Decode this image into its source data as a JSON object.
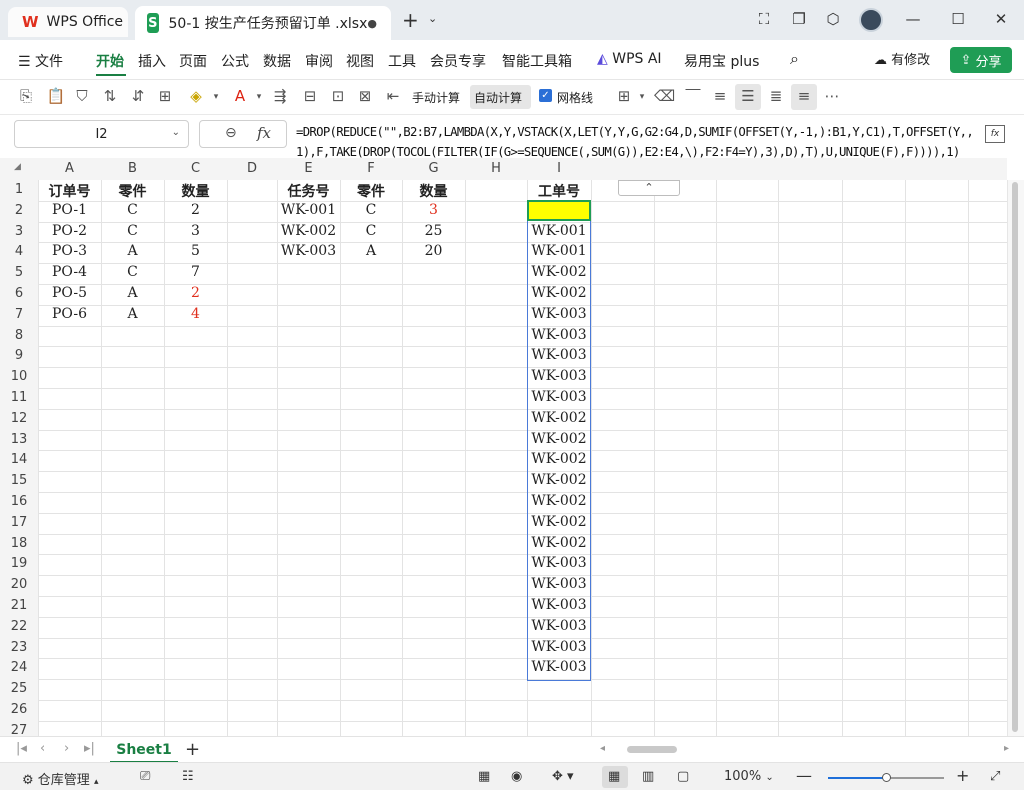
{
  "tabs": {
    "app_tab_label": "WPS Office",
    "file_tab_label": "50-1 按生产任务预留订单 .xlsx",
    "file_badge": "S",
    "modified_dot": "●"
  },
  "menu": {
    "file": "文件",
    "items": [
      "开始",
      "插入",
      "页面",
      "公式",
      "数据",
      "审阅",
      "视图",
      "工具",
      "会员专享",
      "智能工具箱",
      "WPS AI",
      "易用宝 plus"
    ],
    "active": "开始",
    "modify_label": "有修改",
    "share_label": "分享"
  },
  "toolbar": {
    "manual_calc": "手动计算",
    "auto_calc": "自动计算",
    "gridlines": "网格线",
    "gridlines_checked": true
  },
  "formula_bar": {
    "name_box": "I2",
    "formula": "=DROP(REDUCE(\"\",B2:B7,LAMBDA(X,Y,VSTACK(X,LET(Y,Y,G,G2:G4,D,SUMIF(OFFSET(Y,-1,):B1,Y,C1),T,OFFSET(Y,,1),F,TAKE(DROP(TOCOL(FILTER(IF(G>=SEQUENCE(,SUM(G)),E2:E4,\\),F2:F4=Y),3),D),T),U,UNIQUE(F),F)))),1)"
  },
  "columns": [
    "A",
    "B",
    "C",
    "D",
    "E",
    "F",
    "G",
    "H",
    "I"
  ],
  "rows": [
    "1",
    "2",
    "3",
    "4",
    "5",
    "6",
    "7",
    "8",
    "9",
    "10",
    "11",
    "12",
    "13",
    "14",
    "15",
    "16",
    "17",
    "18",
    "19",
    "20",
    "21",
    "22",
    "23",
    "24",
    "25",
    "26",
    "27"
  ],
  "orders": {
    "headers": [
      "订单号",
      "零件",
      "数量"
    ],
    "rows": [
      [
        "PO-1",
        "C",
        "2"
      ],
      [
        "PO-2",
        "C",
        "3"
      ],
      [
        "PO-3",
        "A",
        "5"
      ],
      [
        "PO-4",
        "C",
        "7"
      ],
      [
        "PO-5",
        "A",
        "2"
      ],
      [
        "PO-6",
        "A",
        "4"
      ]
    ]
  },
  "tasks": {
    "headers": [
      "任务号",
      "零件",
      "数量"
    ],
    "rows": [
      [
        "WK-001",
        "C",
        "3"
      ],
      [
        "WK-002",
        "C",
        "25"
      ],
      [
        "WK-003",
        "A",
        "20"
      ]
    ]
  },
  "result": {
    "header": "工单号",
    "values": [
      "WK-001",
      "WK-001",
      "WK-001",
      "WK-002",
      "WK-002",
      "WK-003",
      "WK-003",
      "WK-003",
      "WK-003",
      "WK-003",
      "WK-002",
      "WK-002",
      "WK-002",
      "WK-002",
      "WK-002",
      "WK-002",
      "WK-002",
      "WK-003",
      "WK-003",
      "WK-003",
      "WK-003",
      "WK-003",
      "WK-003"
    ]
  },
  "sheet": {
    "name": "Sheet1"
  },
  "status": {
    "warehouse": "仓库管理",
    "zoom": "100%",
    "zoom_level": 0.5
  },
  "colors": {
    "accent": "#1f9d55",
    "highlight": "#ffff00",
    "spill_border": "#4a7ad8",
    "red_text": "#e0301e"
  }
}
